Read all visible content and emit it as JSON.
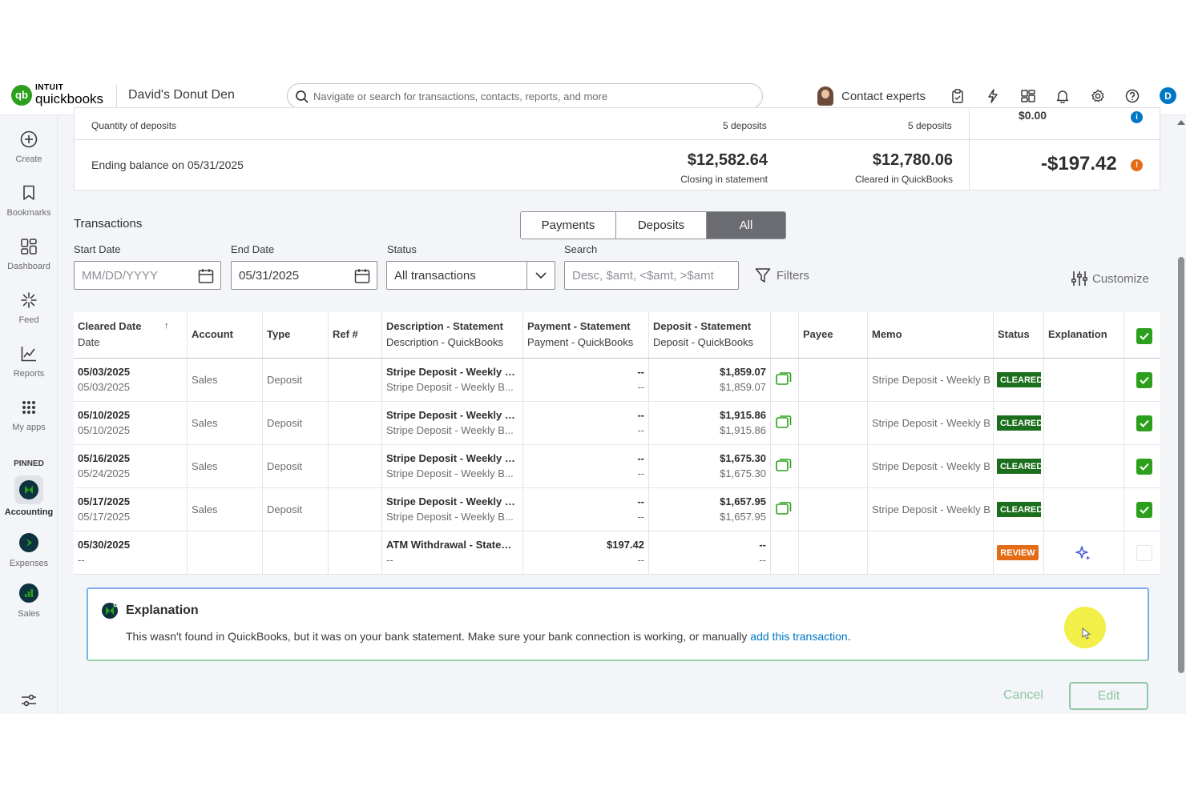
{
  "topbar": {
    "logo_line1": "INTUIT",
    "logo_line2": "quickbooks",
    "logo_mark": "qb",
    "company": "David's Donut Den",
    "search_placeholder": "Navigate or search for transactions, contacts, reports, and more",
    "contact_label": "Contact experts",
    "user_initial": "D",
    "icons": [
      "clipboard-icon",
      "lightning-icon",
      "apps-switch-icon",
      "bell-icon",
      "gear-icon",
      "help-icon"
    ]
  },
  "sidebar": {
    "items": [
      {
        "label": "Create",
        "icon": "plus-circle-icon"
      },
      {
        "label": "Bookmarks",
        "icon": "bookmark-icon"
      },
      {
        "label": "Dashboard",
        "icon": "dashboard-icon"
      },
      {
        "label": "Feed",
        "icon": "sparkle-icon"
      },
      {
        "label": "Reports",
        "icon": "chart-icon"
      },
      {
        "label": "My apps",
        "icon": "grid-icon"
      }
    ],
    "pinned_label": "PINNED",
    "pinned": [
      {
        "label": "Accounting",
        "icon": "accounting-icon"
      },
      {
        "label": "Expenses",
        "icon": "expenses-icon"
      },
      {
        "label": "Sales",
        "icon": "sales-icon"
      }
    ]
  },
  "summary": {
    "qty_label": "Quantity of deposits",
    "qty_statement": "5 deposits",
    "qty_quickbooks": "5 deposits",
    "zero_difference": "$0.00",
    "ending_label": "Ending balance on 05/31/2025",
    "closing_amount": "$12,582.64",
    "closing_label": "Closing in statement",
    "cleared_amount": "$12,780.06",
    "cleared_label": "Cleared in QuickBooks",
    "difference": "-$197.42",
    "info_glyph": "i",
    "warn_glyph": "!"
  },
  "transactions": {
    "title": "Transactions",
    "segments": [
      "Payments",
      "Deposits",
      "All"
    ],
    "selected_segment": "All",
    "filters": {
      "start_label": "Start Date",
      "start_placeholder": "MM/DD/YYYY",
      "end_label": "End Date",
      "end_value": "05/31/2025",
      "status_label": "Status",
      "status_value": "All transactions",
      "search_label": "Search",
      "search_placeholder": "Desc, $amt, <$amt, >$amt",
      "filters_button": "Filters",
      "customize_button": "Customize"
    },
    "columns": {
      "cleared_date": "Cleared Date",
      "sort_arrow": "↑",
      "date": "Date",
      "account": "Account",
      "type": "Type",
      "ref": "Ref #",
      "desc_statement": "Description - Statement",
      "desc_quickbooks": "Description - QuickBooks",
      "pay_statement": "Payment - Statement",
      "pay_quickbooks": "Payment - QuickBooks",
      "dep_statement": "Deposit - Statement",
      "dep_quickbooks": "Deposit - QuickBooks",
      "payee": "Payee",
      "memo": "Memo",
      "status": "Status",
      "explanation": "Explanation"
    },
    "rows": [
      {
        "cleared": "05/03/2025",
        "date": "05/03/2025",
        "account": "Sales",
        "type": "Deposit",
        "ref": "",
        "desc_s": "Stripe Deposit - Weekly B...",
        "desc_q": "Stripe Deposit - Weekly B...",
        "pay_s": "--",
        "pay_q": "--",
        "dep_s": "$1,859.07",
        "dep_q": "$1,859.07",
        "memo": "Stripe Deposit - Weekly B",
        "status": "CLEARED",
        "checked": true
      },
      {
        "cleared": "05/10/2025",
        "date": "05/10/2025",
        "account": "Sales",
        "type": "Deposit",
        "ref": "",
        "desc_s": "Stripe Deposit - Weekly B...",
        "desc_q": "Stripe Deposit - Weekly B...",
        "pay_s": "--",
        "pay_q": "--",
        "dep_s": "$1,915.86",
        "dep_q": "$1,915.86",
        "memo": "Stripe Deposit - Weekly B",
        "status": "CLEARED",
        "checked": true
      },
      {
        "cleared": "05/16/2025",
        "date": "05/24/2025",
        "account": "Sales",
        "type": "Deposit",
        "ref": "",
        "desc_s": "Stripe Deposit - Weekly B...",
        "desc_q": "Stripe Deposit - Weekly B...",
        "pay_s": "--",
        "pay_q": "--",
        "dep_s": "$1,675.30",
        "dep_q": "$1,675.30",
        "memo": "Stripe Deposit - Weekly B",
        "status": "CLEARED",
        "checked": true
      },
      {
        "cleared": "05/17/2025",
        "date": "05/17/2025",
        "account": "Sales",
        "type": "Deposit",
        "ref": "",
        "desc_s": "Stripe Deposit - Weekly B...",
        "desc_q": "Stripe Deposit - Weekly B...",
        "pay_s": "--",
        "pay_q": "--",
        "dep_s": "$1,657.95",
        "dep_q": "$1,657.95",
        "memo": "Stripe Deposit - Weekly B",
        "status": "CLEARED",
        "checked": true
      },
      {
        "cleared": "05/30/2025",
        "date": "--",
        "account": "",
        "type": "",
        "ref": "",
        "desc_s": "ATM Withdrawal - Statem...",
        "desc_q": "--",
        "pay_s": "$197.42",
        "pay_q": "--",
        "dep_s": "--",
        "dep_q": "--",
        "memo": "",
        "status": "REVIEW",
        "checked": false
      }
    ]
  },
  "explanation": {
    "title": "Explanation",
    "body": "This wasn't found in QuickBooks, but it was on your bank statement. Make sure your bank connection is working, or manually ",
    "link": "add this transaction",
    "end": "."
  },
  "footer": {
    "cancel": "Cancel",
    "edit": "Edit"
  },
  "colors": {
    "brand_green": "#2ca01c",
    "cleared_badge": "#1b6e1b",
    "review_badge": "#e46c17",
    "link_blue": "#0077c5",
    "accent_blue": "#0077c5"
  }
}
